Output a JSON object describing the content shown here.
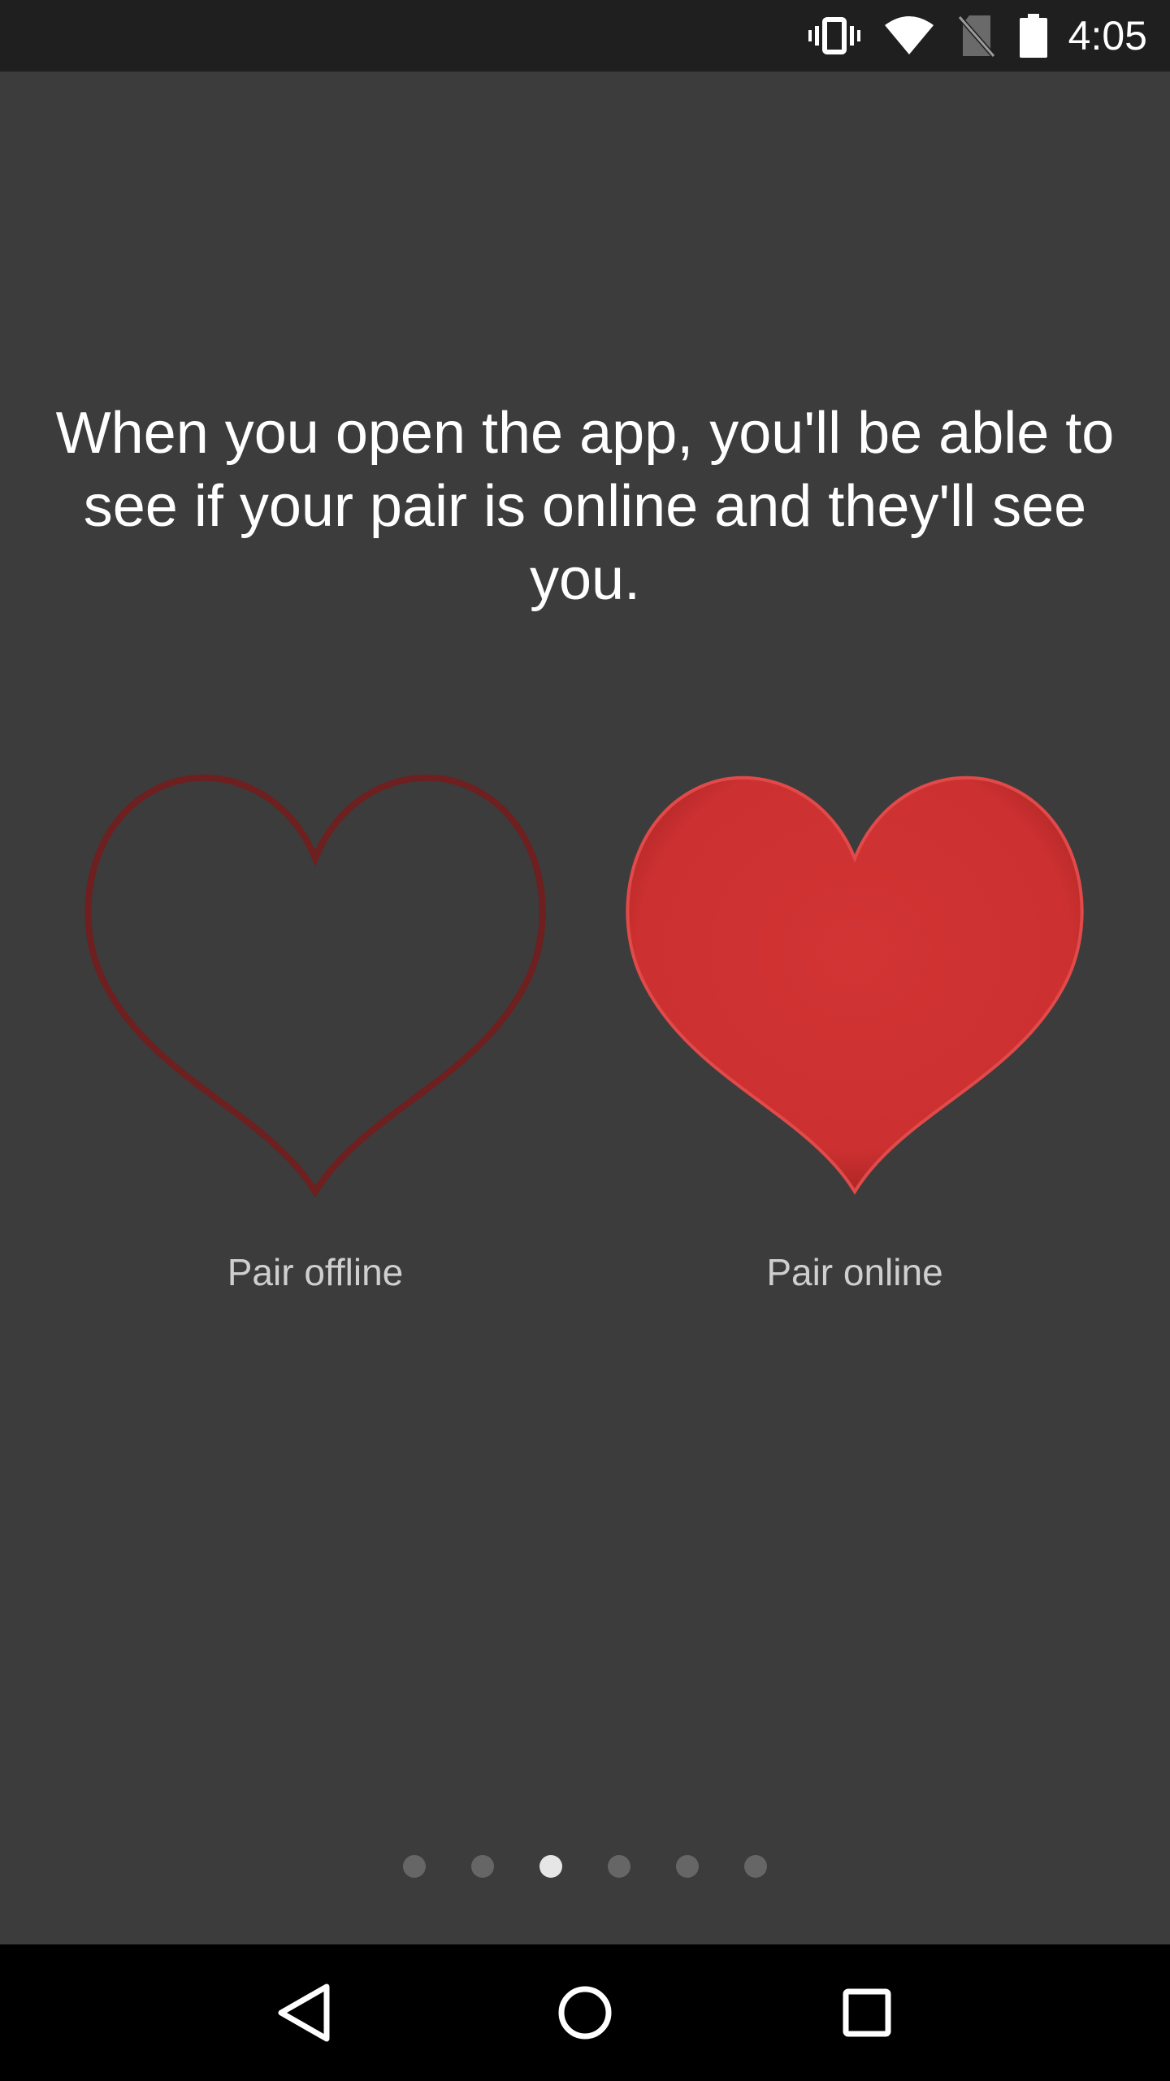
{
  "status_bar": {
    "time": "4:05",
    "icons": [
      "vibrate-icon",
      "wifi-icon",
      "no-sim-icon",
      "battery-icon"
    ]
  },
  "onboarding": {
    "headline": "When you open the app, you'll be able to see if your pair is online and they'll see you.",
    "cards": [
      {
        "label": "Pair offline",
        "icon": "heart-outline-icon",
        "color": "#6e1f1f"
      },
      {
        "label": "Pair online",
        "icon": "heart-filled-icon",
        "color": "#d03232"
      }
    ],
    "pager": {
      "total": 6,
      "active_index": 2
    }
  },
  "nav_bar": {
    "buttons": [
      "back-icon",
      "home-icon",
      "recents-icon"
    ]
  }
}
